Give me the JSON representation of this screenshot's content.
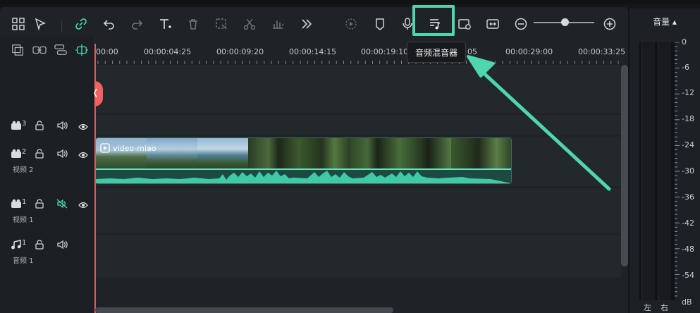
{
  "timeline": {
    "ticks": [
      "00:00",
      "00:00:04:25",
      "00:00:09:20",
      "00:00:14:15",
      "00:00:19:10",
      "05",
      "00:00:29:00",
      "00:00:33:25"
    ]
  },
  "tooltip": {
    "text": "音频混音器"
  },
  "tracks": [
    {
      "num": "3",
      "name": ""
    },
    {
      "num": "2",
      "name": "视频 2"
    },
    {
      "num": "1",
      "name": "视频 1"
    },
    {
      "num": "1",
      "name": "音频 1"
    }
  ],
  "clip": {
    "label": "video-miao"
  },
  "volume": {
    "title": "音量 ▴",
    "db_scale": [
      "0",
      "-6",
      "-12",
      "-18",
      "-24",
      "-30",
      "-36",
      "-42",
      "-48",
      "-54",
      "dB"
    ],
    "left": "左",
    "right": "右"
  },
  "colors": {
    "accent": "#4fd6ae",
    "playhead": "#e45a5a",
    "wave": "#3fc9a5"
  },
  "icons": [
    "layout-icon",
    "select-icon",
    "link-icon",
    "undo-icon",
    "redo-icon",
    "text-icon",
    "delete-icon",
    "crop-icon",
    "cut-icon",
    "audio-stretch-icon",
    "more-icon",
    "render-preview-icon",
    "marker-icon",
    "microphone-icon",
    "audio-mixer-icon",
    "clip-preview-icon",
    "fit-icon",
    "zoom-out-icon",
    "zoom-in-icon"
  ]
}
